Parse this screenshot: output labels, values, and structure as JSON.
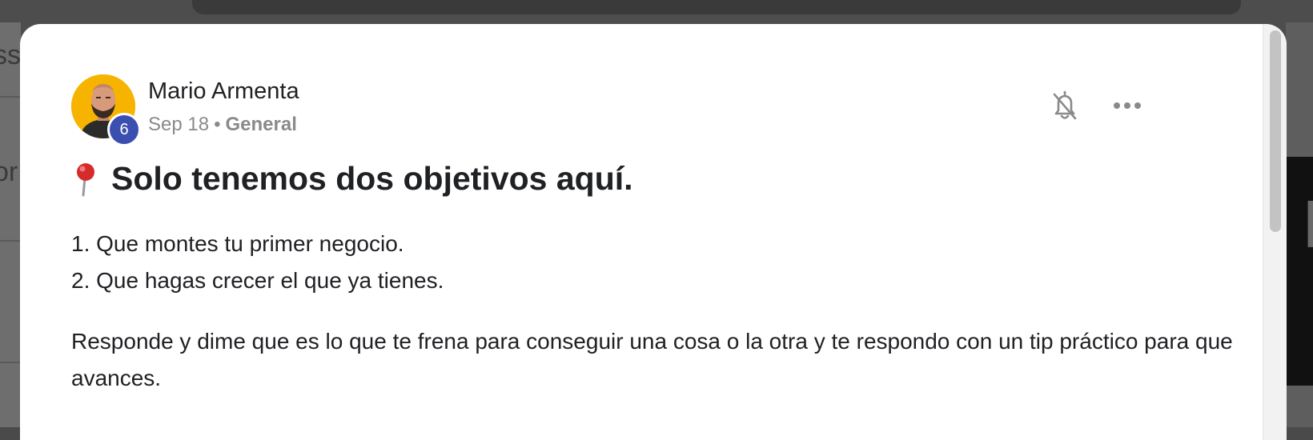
{
  "background": {
    "ghost_left_1": "ss",
    "ghost_left_2": "or",
    "ghost_right": "k"
  },
  "post": {
    "author": {
      "name": "Mario Armenta",
      "level": "6"
    },
    "date": "Sep 18",
    "separator": "•",
    "category": "General",
    "title_icon": "pushpin-icon",
    "title": "Solo tenemos dos objetivos aquí.",
    "lines": [
      "1. Que montes tu primer negocio.",
      "2. Que hagas crecer el que ya tienes."
    ],
    "paragraph": "Responde y dime que es lo que te frena para conseguir una cosa o la otra y te respondo con un tip práctico para que avances."
  },
  "actions": {
    "mute_icon": "bell-off-icon",
    "more_icon": "more-horizontal-icon"
  },
  "colors": {
    "avatar_bg": "#f6b400",
    "badge_bg": "#3b4fb0",
    "text": "#202124",
    "muted": "#8a8a8a",
    "overlay": "#4d4d4d"
  }
}
